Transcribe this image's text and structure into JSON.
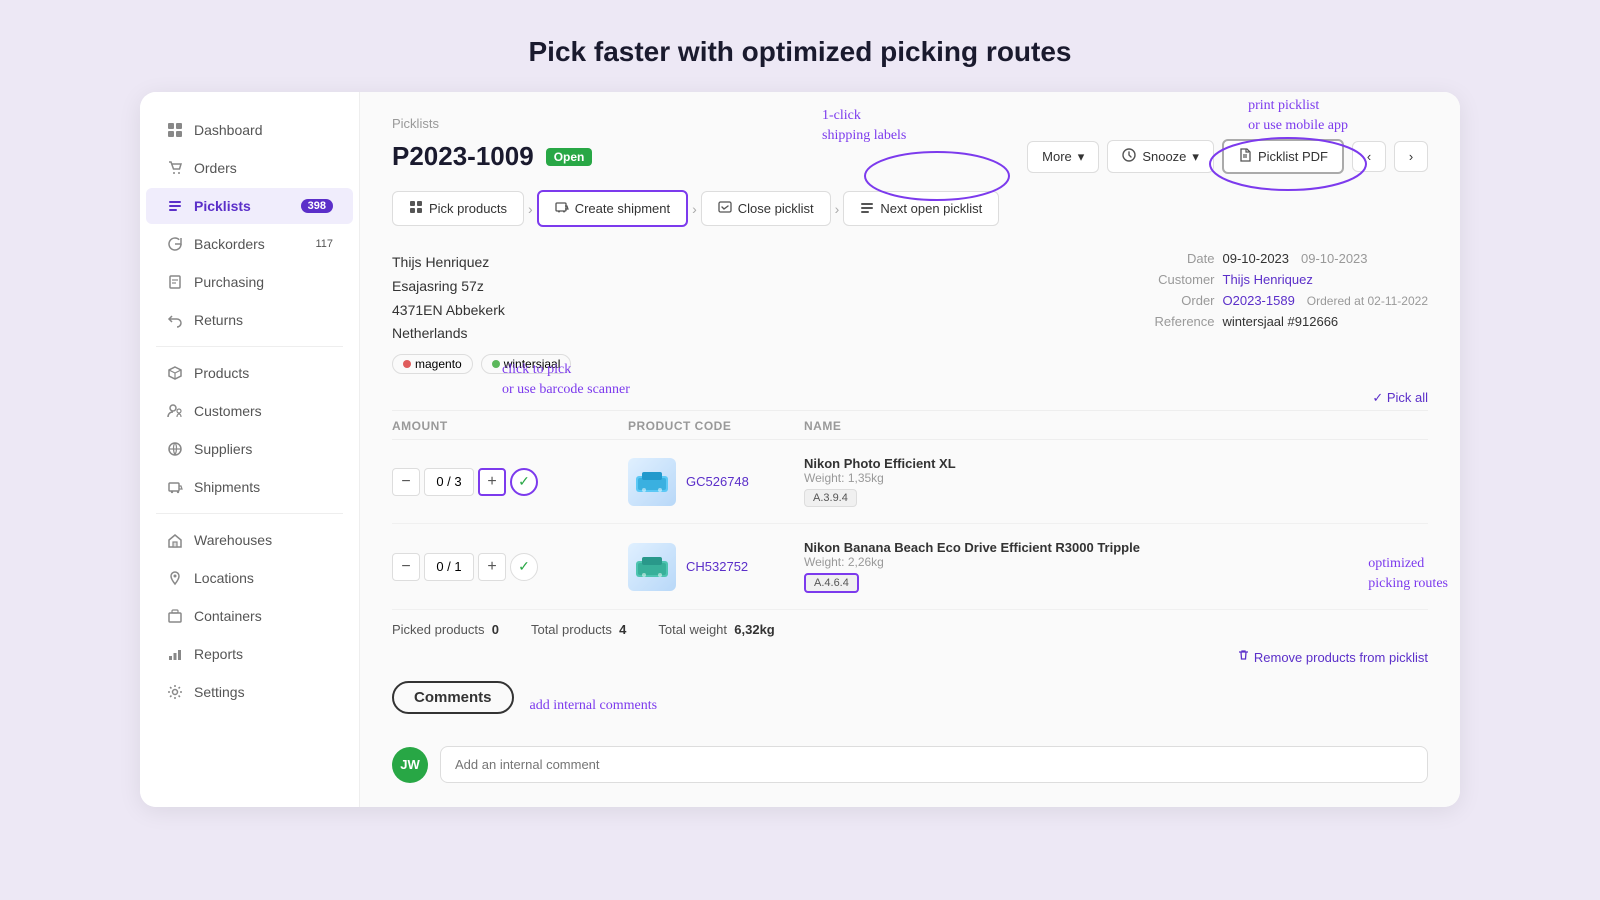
{
  "page": {
    "title": "Pick faster with optimized picking routes"
  },
  "sidebar": {
    "items": [
      {
        "id": "dashboard",
        "label": "Dashboard",
        "icon": "grid",
        "active": false
      },
      {
        "id": "orders",
        "label": "Orders",
        "icon": "cart",
        "active": false
      },
      {
        "id": "picklists",
        "label": "Picklists",
        "icon": "list",
        "active": true,
        "badge": "398"
      },
      {
        "id": "backorders",
        "label": "Backorders",
        "icon": "refresh",
        "active": false,
        "badge": "117"
      },
      {
        "id": "purchasing",
        "label": "Purchasing",
        "icon": "tag",
        "active": false
      },
      {
        "id": "returns",
        "label": "Returns",
        "icon": "undo",
        "active": false
      },
      {
        "id": "products",
        "label": "Products",
        "icon": "box",
        "active": false
      },
      {
        "id": "customers",
        "label": "Customers",
        "icon": "users",
        "active": false
      },
      {
        "id": "suppliers",
        "label": "Suppliers",
        "icon": "globe",
        "active": false
      },
      {
        "id": "shipments",
        "label": "Shipments",
        "icon": "truck",
        "active": false
      },
      {
        "id": "warehouses",
        "label": "Warehouses",
        "icon": "building",
        "active": false
      },
      {
        "id": "locations",
        "label": "Locations",
        "icon": "pin",
        "active": false
      },
      {
        "id": "containers",
        "label": "Containers",
        "icon": "layers",
        "active": false
      },
      {
        "id": "reports",
        "label": "Reports",
        "icon": "bar-chart",
        "active": false
      },
      {
        "id": "settings",
        "label": "Settings",
        "icon": "gear",
        "active": false
      }
    ]
  },
  "main": {
    "breadcrumb": "Picklists",
    "picklist_number": "P2023-1009",
    "status_badge": "Open",
    "header_buttons": {
      "more": "More",
      "snooze": "Snooze",
      "picklist_pdf": "Picklist PDF"
    },
    "workflow_steps": [
      {
        "label": "Pick products",
        "icon": "grid"
      },
      {
        "label": "Create shipment",
        "icon": "box"
      },
      {
        "label": "Close picklist",
        "icon": "check-square"
      },
      {
        "label": "Next open picklist",
        "icon": "list"
      }
    ],
    "address": {
      "name": "Thijs Henriquez",
      "street": "Esajasring 57z",
      "postal": "4371EN Abbekerk",
      "country": "Netherlands"
    },
    "tags": [
      {
        "label": "magento",
        "color": "#e05c5c"
      },
      {
        "label": "wintersjaal",
        "color": "#5cb85c"
      }
    ],
    "details": {
      "date_label": "Date",
      "date_value": "09-10-2023",
      "date_extra": "09-10-2023",
      "customer_label": "Customer",
      "customer_value": "Thijs Henriquez",
      "order_label": "Order",
      "order_value": "O2023-1589",
      "order_extra": "Ordered at 02-11-2022",
      "reference_label": "Reference",
      "reference_value": "wintersjaal #912666"
    },
    "pick_all_btn": "✓ Pick all",
    "columns": {
      "amount": "Amount",
      "product_code": "Product code",
      "name": "Name"
    },
    "products": [
      {
        "amount_current": "0",
        "amount_total": "3",
        "code": "GC526748",
        "name": "Nikon Photo Efficient XL",
        "weight_label": "Weight:",
        "weight_value": "1,35kg",
        "location": "A.3.9.4",
        "img_emoji": "📦"
      },
      {
        "amount_current": "0",
        "amount_total": "1",
        "code": "CH532752",
        "name": "Nikon Banana Beach Eco Drive Efficient R3000 Tripple",
        "weight_label": "Weight:",
        "weight_value": "2,26kg",
        "location": "A.4.6.4",
        "img_emoji": "📦"
      }
    ],
    "summary": {
      "picked_label": "Picked products",
      "picked_value": "0",
      "total_label": "Total products",
      "total_value": "4",
      "weight_label": "Total weight",
      "weight_value": "6,32kg"
    },
    "remove_link": "Remove products from picklist",
    "comments": {
      "header": "Comments",
      "placeholder": "Add an internal comment",
      "avatar_initials": "JW"
    }
  },
  "annotations": {
    "shipping_labels": "1-click\nshipping labels",
    "print_picklist": "print picklist\nor use mobile app",
    "click_to_pick": "click to pick\nor use barcode scanner",
    "optimized_picking": "optimized\npicking routes",
    "add_comments": "add internal comments"
  },
  "icons": {
    "grid": "⊞",
    "cart": "🛒",
    "list": "≡",
    "refresh": "↩",
    "tag": "🏷",
    "undo": "↩",
    "box": "📦",
    "users": "👥",
    "globe": "🌐",
    "truck": "🚚",
    "building": "🏢",
    "pin": "📍",
    "layers": "⬛",
    "bar-chart": "📊",
    "gear": "⚙"
  }
}
